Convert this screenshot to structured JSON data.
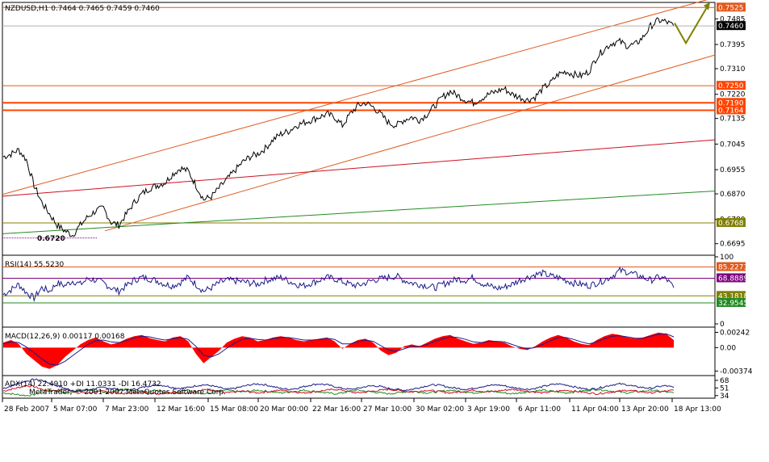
{
  "chart_data": [
    {
      "type": "line",
      "panel": "price",
      "symbol_header": "NZDUSD,H1  0.7464 0.7465 0.7459 0.7460",
      "ylim": [
        0.666,
        0.754
      ],
      "y_ticks": [
        "0.7485",
        "0.7395",
        "0.7310",
        "0.7220",
        "0.7135",
        "0.7045",
        "0.6955",
        "0.6870",
        "0.6780",
        "0.6695"
      ],
      "y_tick_values": [
        0.7485,
        0.7395,
        0.731,
        0.722,
        0.7135,
        0.7045,
        0.6955,
        0.687,
        0.678,
        0.6695
      ],
      "x_ticks": [
        "28 Feb 2007",
        "5 Mar 07:00",
        "7 Mar 23:00",
        "12 Mar 16:00",
        "15 Mar 08:00",
        "20 Mar 00:00",
        "22 Mar 16:00",
        "27 Mar 10:00",
        "30 Mar 02:00",
        "3 Apr 19:00",
        "6 Apr 11:00",
        "11 Apr 04:00",
        "13 Apr 20:00",
        "18 Apr 13:00"
      ],
      "series": [
        {
          "values": [
            0.7,
            0.701,
            0.7025,
            0.699,
            0.69,
            0.684,
            0.68,
            0.676,
            0.674,
            0.6725,
            0.676,
            0.679,
            0.681,
            0.682,
            0.677,
            0.676,
            0.68,
            0.684,
            0.687,
            0.689,
            0.69,
            0.691,
            0.694,
            0.696,
            0.695,
            0.69,
            0.685,
            0.686,
            0.689,
            0.692,
            0.695,
            0.698,
            0.7,
            0.701,
            0.703,
            0.706,
            0.708,
            0.709,
            0.711,
            0.712,
            0.713,
            0.714,
            0.715,
            0.714,
            0.711,
            0.715,
            0.718,
            0.719,
            0.7175,
            0.715,
            0.712,
            0.711,
            0.713,
            0.714,
            0.713,
            0.715,
            0.718,
            0.721,
            0.723,
            0.7215,
            0.72,
            0.719,
            0.7205,
            0.722,
            0.723,
            0.724,
            0.722,
            0.721,
            0.72,
            0.721,
            0.724,
            0.726,
            0.729,
            0.73,
            0.729,
            0.7285,
            0.73,
            0.735,
            0.738,
            0.74,
            0.7405,
            0.739,
            0.7395,
            0.742,
            0.746,
            0.748,
            0.7475,
            0.746
          ]
        }
      ],
      "horizontal_levels": [
        {
          "label": "0.7525",
          "value": 0.7525,
          "color": "#e05a1e"
        },
        {
          "label": "0.7250",
          "value": 0.725,
          "color": "#e05a1e"
        },
        {
          "label": "0.7190",
          "value": 0.719,
          "color": "#ff4500"
        },
        {
          "label": "0.7164",
          "value": 0.7164,
          "color": "#ff4500"
        },
        {
          "label": "0.6768",
          "value": 0.6768,
          "color": "#808000"
        }
      ],
      "current_price_label": "0.7460",
      "low_annotation": "0.6720",
      "colors": {
        "price": "#000000",
        "channel": "#e05a1e",
        "trend_red": "#cc1122",
        "trend_green": "#228b22",
        "forecast": "#808000"
      }
    },
    {
      "type": "line",
      "panel": "rsi",
      "title": "RSI(14) 55.5230",
      "ylim": [
        0,
        100
      ],
      "y_ticks": [
        "100",
        "0"
      ],
      "levels": [
        {
          "label": "85.2273",
          "value": 85.2273,
          "color": "#e05a1e"
        },
        {
          "label": "68.8889",
          "value": 68.8889,
          "color": "#800080"
        },
        {
          "label": "43.1818",
          "value": 43.1818,
          "color": "#808000"
        },
        {
          "label": "32.9545",
          "value": 32.9545,
          "color": "#228b22"
        }
      ],
      "series": [
        {
          "values": [
            45,
            52,
            60,
            48,
            40,
            55,
            50,
            62,
            58,
            65,
            60,
            68,
            66,
            62,
            55,
            50,
            58,
            66,
            70,
            68,
            65,
            60,
            58,
            63,
            70,
            60,
            50,
            55,
            62,
            66,
            65,
            64,
            62,
            60,
            66,
            68,
            70,
            65,
            60,
            58,
            62,
            66,
            70,
            68,
            64,
            60,
            58,
            62,
            66,
            68,
            70,
            72,
            66,
            62,
            60,
            58,
            55,
            60,
            64,
            68,
            66,
            70,
            62,
            58,
            54,
            56,
            60,
            66,
            70,
            74,
            76,
            72,
            70,
            66,
            62,
            60,
            58,
            62,
            66,
            72,
            80,
            78,
            74,
            70,
            66,
            70,
            68,
            55
          ]
        }
      ]
    },
    {
      "type": "area",
      "panel": "macd",
      "title": "MACD(12,26,9) 0.00117 0.00168",
      "ylim": [
        -0.0042,
        0.003
      ],
      "y_ticks": [
        "0.00242",
        "0.00",
        "-0.00374"
      ],
      "y_tick_values": [
        0.00242,
        0.0,
        -0.00374
      ],
      "series": [
        {
          "name": "histogram",
          "values": [
            0.0008,
            0.0012,
            0.0006,
            -0.001,
            -0.002,
            -0.003,
            -0.0034,
            -0.0028,
            -0.0015,
            -0.0005,
            0.0005,
            0.0012,
            0.0016,
            0.001,
            0.0005,
            0.0008,
            0.0014,
            0.0018,
            0.002,
            0.0015,
            0.0012,
            0.001,
            0.0016,
            0.0018,
            0.001,
            -0.001,
            -0.0025,
            -0.0015,
            -0.0005,
            0.0008,
            0.0014,
            0.0018,
            0.0016,
            0.001,
            0.0012,
            0.0016,
            0.0018,
            0.0016,
            0.0012,
            0.001,
            0.0012,
            0.0014,
            0.0016,
            0.001,
            -0.0002,
            0.0006,
            0.0012,
            0.0014,
            0.0008,
            -0.0005,
            -0.0012,
            -0.0008,
            0.0002,
            0.0005,
            0.0002,
            0.0008,
            0.0014,
            0.0018,
            0.002,
            0.0014,
            0.001,
            0.0006,
            0.0008,
            0.0012,
            0.001,
            0.0008,
            0.0002,
            -0.0002,
            -0.0004,
            0.0002,
            0.001,
            0.0016,
            0.002,
            0.0016,
            0.001,
            0.0006,
            0.0004,
            0.0012,
            0.0018,
            0.0022,
            0.002,
            0.0016,
            0.0014,
            0.0016,
            0.002,
            0.0024,
            0.0022,
            0.0012
          ]
        },
        {
          "name": "signal",
          "values": [
            0.0006,
            0.0009,
            0.0008,
            0.0001,
            -0.0008,
            -0.0018,
            -0.0026,
            -0.0028,
            -0.0022,
            -0.0013,
            -0.0004,
            0.0005,
            0.0011,
            0.0012,
            0.0009,
            0.0008,
            0.0011,
            0.0015,
            0.0018,
            0.0017,
            0.0014,
            0.0012,
            0.0014,
            0.0016,
            0.0013,
            0.0002,
            -0.0012,
            -0.0015,
            -0.001,
            -0.0001,
            0.0007,
            0.0013,
            0.0015,
            0.0013,
            0.0012,
            0.0014,
            0.0016,
            0.0016,
            0.0014,
            0.0012,
            0.0012,
            0.0013,
            0.0015,
            0.0013,
            0.0006,
            0.0006,
            0.0009,
            0.0012,
            0.001,
            0.0003,
            -0.0004,
            -0.0006,
            -0.0002,
            0.0002,
            0.0002,
            0.0005,
            0.001,
            0.0014,
            0.0017,
            0.0016,
            0.0013,
            0.0009,
            0.0008,
            0.001,
            0.001,
            0.0009,
            0.0005,
            0.0001,
            -0.0002,
            0.0,
            0.0005,
            0.0011,
            0.0016,
            0.0016,
            0.0013,
            0.0009,
            0.0006,
            0.0009,
            0.0014,
            0.0018,
            0.0019,
            0.0017,
            0.0015,
            0.0015,
            0.0018,
            0.0021,
            0.0022,
            0.0017
          ]
        }
      ]
    },
    {
      "type": "line",
      "panel": "adx",
      "title": "ADX(14) 22.4910 +DI 11.0331 -DI 16.4732",
      "watermark": "MetaTrader, © 2001-2007 MetaQuotes Software Corp.",
      "ylim": [
        30,
        75
      ],
      "y_ticks": [
        "68",
        "51",
        "34"
      ],
      "y_tick_values": [
        68,
        51,
        34
      ],
      "series": [
        {
          "name": "ADX",
          "color": "#1a1a8a",
          "values": [
            50,
            55,
            62,
            66,
            70,
            68,
            62,
            56,
            50,
            46,
            44,
            46,
            50,
            52,
            50,
            48,
            46,
            48,
            52,
            56,
            58,
            56,
            52,
            50,
            52,
            56,
            58,
            56,
            52,
            48,
            50,
            54,
            58,
            60,
            58,
            54,
            50,
            48,
            50,
            54,
            58,
            60,
            58,
            54,
            50,
            48,
            50,
            54,
            56,
            54,
            50,
            48,
            46,
            48,
            52,
            56,
            58,
            56,
            52,
            50,
            48,
            50,
            54,
            56,
            58,
            56,
            52,
            50,
            48,
            50,
            54,
            58,
            60,
            58,
            54,
            50,
            48,
            50,
            54,
            58,
            60,
            58,
            54,
            52,
            50,
            54,
            56,
            52
          ]
        },
        {
          "name": "+DI",
          "color": "#228b22",
          "values": [
            40,
            38,
            36,
            34,
            36,
            42,
            46,
            44,
            40,
            42,
            46,
            48,
            44,
            40,
            42,
            46,
            48,
            44,
            42,
            44,
            46,
            42,
            40,
            44,
            46,
            42,
            38,
            40,
            44,
            46,
            44,
            42,
            44,
            46,
            44,
            42,
            40,
            42,
            44,
            46,
            44,
            42,
            40,
            38,
            40,
            44,
            46,
            44,
            42,
            40,
            38,
            40,
            42,
            44,
            42,
            40,
            42,
            44,
            46,
            44,
            42,
            40,
            42,
            44,
            42,
            40,
            38,
            40,
            42,
            44,
            46,
            44,
            42,
            40,
            42,
            44,
            46,
            48,
            46,
            44,
            42,
            40,
            42,
            44,
            46,
            44,
            42,
            40
          ]
        },
        {
          "name": "-DI",
          "color": "#cc1122",
          "values": [
            44,
            48,
            52,
            56,
            54,
            48,
            44,
            46,
            48,
            44,
            42,
            40,
            42,
            44,
            42,
            40,
            38,
            40,
            42,
            40,
            38,
            40,
            42,
            40,
            38,
            44,
            48,
            46,
            42,
            40,
            42,
            44,
            42,
            40,
            42,
            44,
            46,
            44,
            42,
            40,
            42,
            44,
            46,
            48,
            46,
            42,
            40,
            42,
            44,
            46,
            48,
            46,
            44,
            42,
            44,
            46,
            44,
            42,
            40,
            42,
            44,
            46,
            44,
            42,
            44,
            46,
            48,
            46,
            44,
            42,
            40,
            42,
            44,
            46,
            44,
            42,
            40,
            38,
            40,
            42,
            44,
            46,
            44,
            42,
            40,
            42,
            44,
            46
          ]
        }
      ]
    }
  ]
}
